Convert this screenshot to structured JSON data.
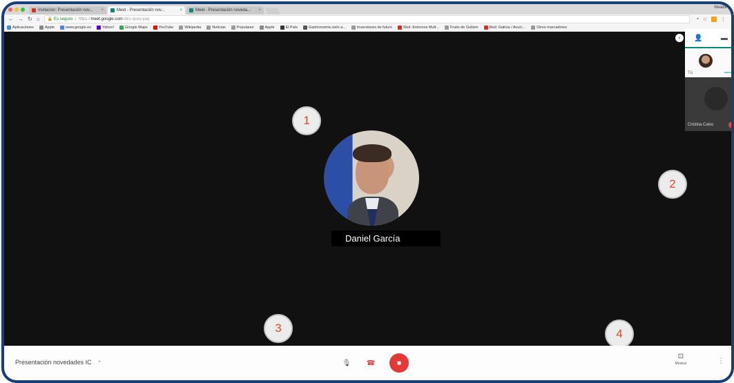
{
  "browser": {
    "tabs": [
      {
        "label": "Invitación: Presentación nov...",
        "favicon_color": "#d93025",
        "active": false
      },
      {
        "label": "Meet - Presentación nov...",
        "favicon_color": "#00897b",
        "active": true
      },
      {
        "label": "Meet - Presentación noveda...",
        "favicon_color": "#00897b",
        "active": false
      }
    ],
    "profile_name": "Nivalor",
    "url_secure_label": "Es seguro",
    "url_scheme": "https://",
    "url_host": "meet.google.com",
    "url_path": "/dcc-qcoo-yaq",
    "bookmarks": [
      {
        "label": "Aplicaciones",
        "color": "#4a90d9"
      },
      {
        "label": "Apple",
        "color": "#888888"
      },
      {
        "label": "www.google.es",
        "color": "#4285f4"
      },
      {
        "label": "Yahoo!",
        "color": "#6001d2"
      },
      {
        "label": "Google Maps",
        "color": "#34a853"
      },
      {
        "label": "YouTube",
        "color": "#ff0000"
      },
      {
        "label": "Wikipedia",
        "color": "#999999"
      },
      {
        "label": "Noticias",
        "color": "#999999"
      },
      {
        "label": "Populares",
        "color": "#999999"
      },
      {
        "label": "Apple",
        "color": "#888888"
      },
      {
        "label": "El País",
        "color": "#333333"
      },
      {
        "label": "Gastronomía cielo a...",
        "color": "#555555"
      },
      {
        "label": "Inversiones de futuro",
        "color": "#999999"
      },
      {
        "label": "Red: Entornos Mult...",
        "color": "#d93025"
      },
      {
        "label": "Fruits de Golden",
        "color": "#999999"
      },
      {
        "label": "Red: Galicia / Acuíc...",
        "color": "#d93025"
      },
      {
        "label": "Otros marcadores",
        "color": "#999999"
      }
    ]
  },
  "stage": {
    "participant_name": "Daniel García"
  },
  "side_panel": {
    "self_label": "Tú",
    "other_label": "Cristina Calvo"
  },
  "callouts": [
    "1",
    "2",
    "3",
    "4"
  ],
  "bottombar": {
    "meeting_title": "Presentación novedades IC",
    "present_label": "Mostrar",
    "colors": {
      "end_call": "#e53935",
      "camera_off": "#e53935"
    }
  }
}
